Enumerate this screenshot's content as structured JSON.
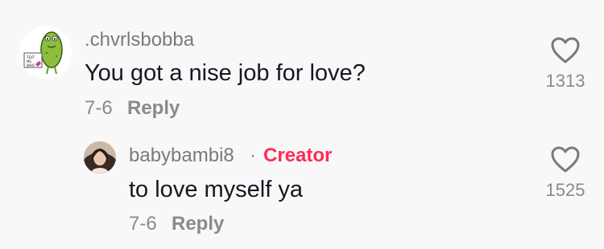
{
  "comments": [
    {
      "username": ".chvrlsbobba",
      "text": "You got a nise job for love?",
      "date": "7-6",
      "reply_label": "Reply",
      "likes": "1313",
      "avatar_badge_lines": [
        "TEXT",
        "ME",
        "WHO"
      ]
    },
    {
      "username": "babybambi8",
      "separator": "·",
      "badge": "Creator",
      "text": "to love myself ya",
      "date": "7-6",
      "reply_label": "Reply",
      "likes": "1525"
    }
  ],
  "colors": {
    "background": "#f8f8f8",
    "creator_badge": "#fe2c55",
    "secondary_text": "#8a8a8a",
    "primary_text": "#161823"
  },
  "icons": {
    "like": "heart-outline-icon"
  }
}
